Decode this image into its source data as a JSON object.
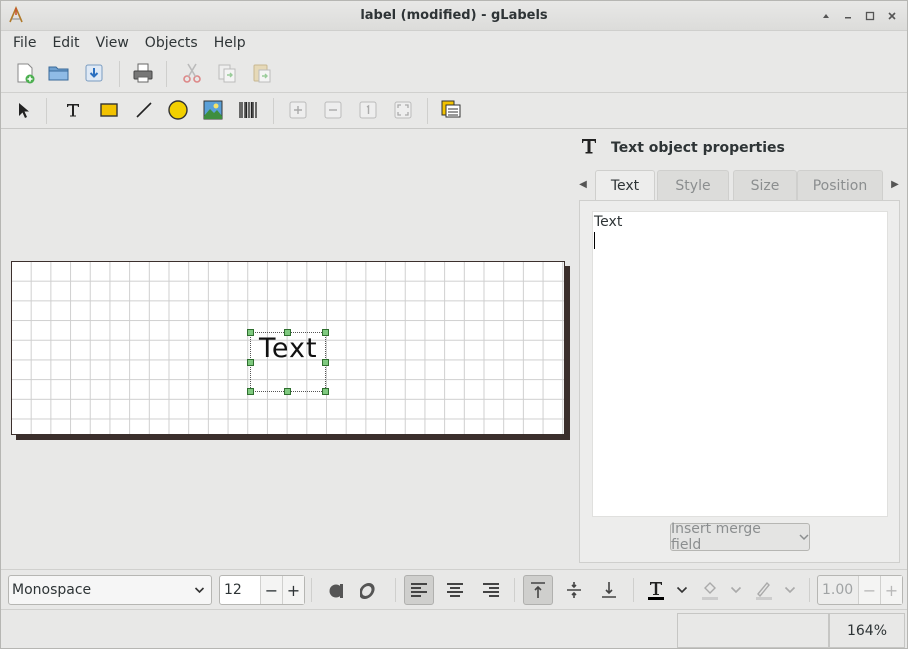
{
  "window": {
    "title": "label (modified) - gLabels"
  },
  "menubar": {
    "items": [
      "File",
      "Edit",
      "View",
      "Objects",
      "Help"
    ]
  },
  "toolbar_main": {
    "buttons": [
      "new-icon",
      "open-icon",
      "save-icon",
      "print-icon",
      "cut-icon",
      "copy-icon",
      "paste-icon"
    ]
  },
  "toolbar_objects": {
    "buttons": [
      "select-arrow-icon",
      "text-tool-icon",
      "box-tool-icon",
      "line-tool-icon",
      "ellipse-tool-icon",
      "image-tool-icon",
      "barcode-tool-icon",
      "zoom-in-icon",
      "zoom-out-icon",
      "zoom-1to1-icon",
      "zoom-fit-icon",
      "merge-properties-icon"
    ]
  },
  "canvas": {
    "text_object": "Text"
  },
  "properties": {
    "title": "Text object properties",
    "tabs": [
      {
        "label": "Text",
        "active": true
      },
      {
        "label": "Style",
        "active": false
      },
      {
        "label": "Size",
        "active": false
      },
      {
        "label": "Position",
        "active": false
      }
    ],
    "text_content": "Text",
    "merge_button": "Insert merge field"
  },
  "prop_toolbar": {
    "font_family": "Monospace",
    "font_size": "12",
    "line_width": "1.00"
  },
  "statusbar": {
    "zoom": "164%"
  },
  "colors": {
    "handle_fill": "#7fc97f",
    "label_border": "#3b2f2c",
    "grid": "#cfcfcf"
  }
}
